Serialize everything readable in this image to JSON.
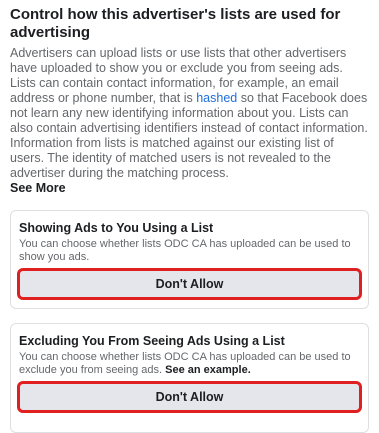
{
  "section": {
    "title": "Control how this advertiser's lists are used for advertising",
    "body_before_link": "Advertisers can upload lists or use lists that other advertisers have uploaded to show you or exclude you from seeing ads. Lists can contain contact information, for example, an email address or phone number, that is ",
    "link": "hashed",
    "body_after_link": " so that Facebook does not learn any new identifying information about you. Lists can also contain advertising identifiers instead of contact information. Information from lists is matched against our existing list of users. The identity of matched users is not revealed to the advertiser during the matching process.",
    "see_more": "See More"
  },
  "cards": [
    {
      "title": "Showing Ads to You Using a List",
      "description": "You can choose whether lists ODC CA has uploaded can be used to show you ads.",
      "example_link": "",
      "button": "Don't Allow"
    },
    {
      "title": "Excluding You From Seeing Ads Using a List",
      "description": "You can choose whether lists ODC CA has uploaded can be used to exclude you from seeing ads. ",
      "example_link": "See an example.",
      "button": "Don't Allow"
    }
  ],
  "colors": {
    "link": "#216fdb",
    "highlight_border": "#e02020",
    "button_bg": "#e4e6eb"
  }
}
